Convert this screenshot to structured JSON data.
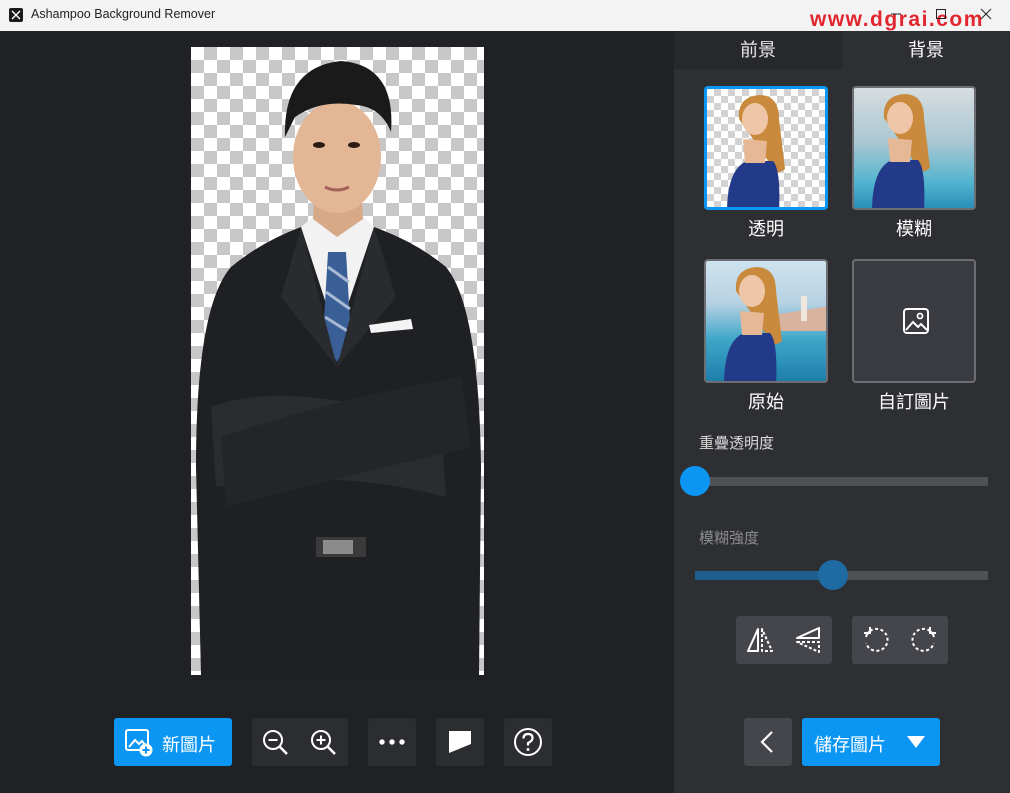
{
  "window": {
    "title": "Ashampoo Background Remover",
    "watermark": "www.dgrai.com"
  },
  "tabs": [
    {
      "label": "前景",
      "active": false
    },
    {
      "label": "背景",
      "active": true
    }
  ],
  "backgrounds": {
    "options": [
      {
        "label": "透明",
        "selected": true
      },
      {
        "label": "模糊",
        "selected": false
      },
      {
        "label": "原始",
        "selected": false
      },
      {
        "label": "自訂圖片",
        "selected": false
      }
    ]
  },
  "sliders": {
    "overlay_opacity": {
      "label": "重疊透明度",
      "value_fraction": 0.0,
      "enabled": true
    },
    "blur_strength": {
      "label": "模糊強度",
      "value_fraction": 0.47,
      "enabled": false
    }
  },
  "toolbar": {
    "new_image_label": "新圖片",
    "icons": [
      "add-image-icon",
      "zoom-out-icon",
      "zoom-in-icon",
      "more-icon",
      "compare-icon",
      "help-icon"
    ]
  },
  "actions": {
    "save_label": "儲存圖片",
    "icons": [
      "flip-horizontal-icon",
      "flip-vertical-icon",
      "rotate-left-icon",
      "rotate-right-icon",
      "back-icon",
      "dropdown-arrow-icon"
    ]
  },
  "colors": {
    "accent": "#0b96f3",
    "panel": "#2e2f33",
    "canvas": "#202124",
    "watermark": "#e2262f"
  }
}
